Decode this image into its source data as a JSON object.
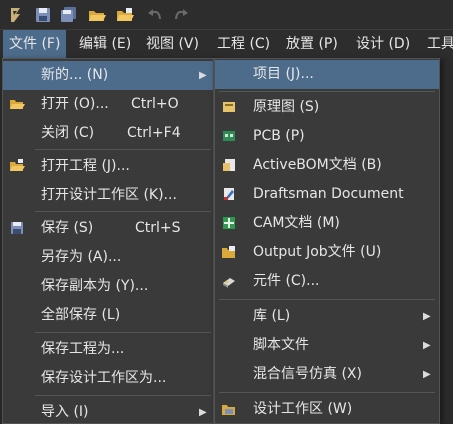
{
  "toolbar": {
    "icons": [
      "app-logo-icon",
      "save-icon",
      "save-all-icon",
      "open-folder-icon",
      "open-project-icon",
      "undo-icon",
      "redo-icon"
    ]
  },
  "menubar": {
    "file": "文件 (F)",
    "edit": "编辑 (E)",
    "view": "视图 (V)",
    "project": "工程 (C)",
    "place": "放置 (P)",
    "design": "设计 (D)",
    "tools": "工具"
  },
  "file_menu": {
    "new": "新的... (N)",
    "open": "打开 (O)...",
    "open_shortcut": "Ctrl+O",
    "close": "关闭 (C)",
    "close_shortcut": "Ctrl+F4",
    "open_project": "打开工程 (J)...",
    "open_workspace": "打开设计工作区 (K)...",
    "save": "保存 (S)",
    "save_shortcut": "Ctrl+S",
    "save_as": "另存为 (A)...",
    "save_copy_as": "保存副本为 (Y)...",
    "save_all": "全部保存 (L)",
    "save_project_as": "保存工程为...",
    "save_workspace_as": "保存设计工作区为...",
    "import": "导入 (I)"
  },
  "new_submenu": {
    "project": "项目 (J)...",
    "schematic": "原理图 (S)",
    "pcb": "PCB (P)",
    "activebom": "ActiveBOM文档 (B)",
    "draftsman": "Draftsman Document",
    "cam": "CAM文档 (M)",
    "output_job": "Output Job文件 (U)",
    "component": "元件 (C)...",
    "library": "库 (L)",
    "script": "脚本文件",
    "mixed_sim": "混合信号仿真 (X)",
    "workspace": "设计工作区 (W)"
  },
  "colors": {
    "highlight": "#4d6c8c",
    "menu_bg": "#3a3a3a",
    "bar_bg": "#2d2d2d"
  }
}
